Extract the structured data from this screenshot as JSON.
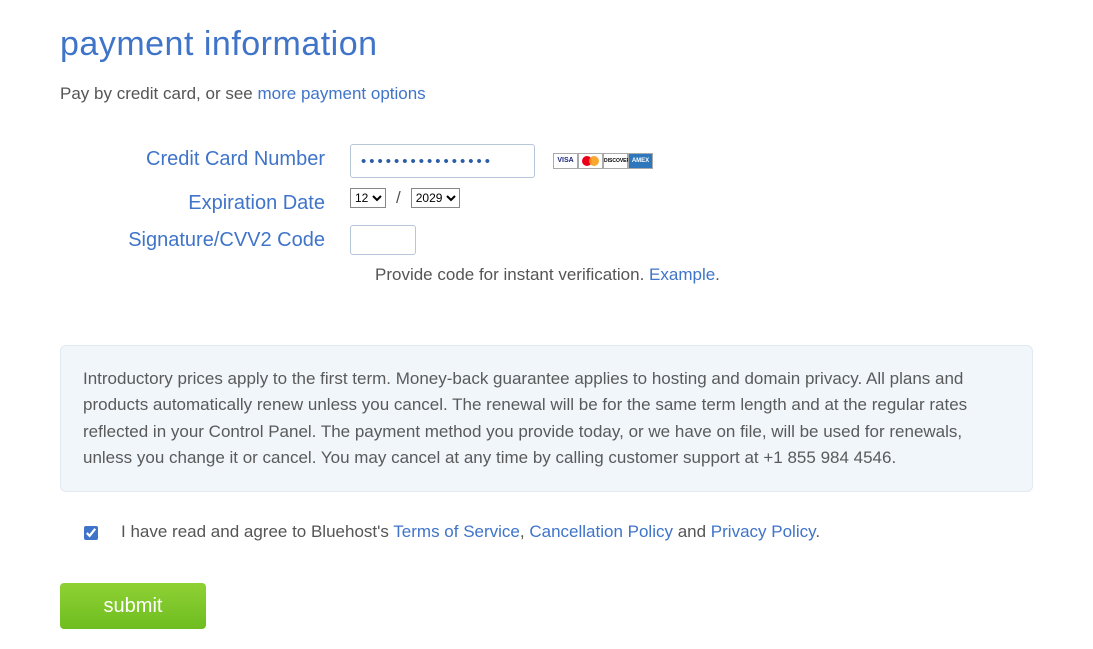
{
  "title": "payment information",
  "intro": {
    "prefix": "Pay by credit card, or see ",
    "link": "more payment options"
  },
  "form": {
    "cc_label": "Credit Card Number",
    "cc_value": "••••••••••••••••",
    "exp_label": "Expiration Date",
    "exp_month": "12",
    "exp_year": "2029",
    "exp_separator": "/",
    "cvv_label": "Signature/CVV2 Code",
    "cvv_value": "",
    "cvv_helper_prefix": "Provide code for instant verification. ",
    "cvv_helper_link": "Example",
    "cvv_helper_suffix": ".",
    "cards": {
      "visa": "VISA",
      "mastercard": "",
      "discover": "DISCOVER",
      "amex": "AMEX"
    }
  },
  "disclaimer": "Introductory prices apply to the first term. Money-back guarantee applies to hosting and domain privacy. All plans and products automatically renew unless you cancel. The renewal will be for the same term length and at the regular rates reflected in your Control Panel. The payment method you provide today, or we have on file, will be used for renewals, unless you change it or cancel. You may cancel at any time by calling customer support at +1 855 984 4546.",
  "agree": {
    "checked": true,
    "prefix": "I have read and agree to Bluehost's ",
    "tos": "Terms of Service",
    "sep1": ", ",
    "cancel": "Cancellation Policy",
    "sep2": " and ",
    "privacy": "Privacy Policy",
    "suffix": "."
  },
  "submit_label": "submit"
}
